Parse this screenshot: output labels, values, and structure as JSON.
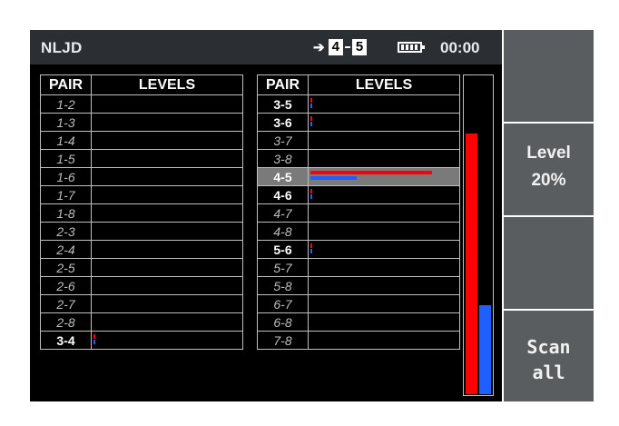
{
  "header": {
    "title": "NLJD",
    "pair_from": "4",
    "pair_to": "5",
    "battery_icon": "battery-full-icon",
    "time": "00:00"
  },
  "table_left": {
    "headers": [
      "PAIR",
      "LEVELS"
    ],
    "rows": [
      {
        "pair": "1-2",
        "active": false,
        "red": 0,
        "blue": 0
      },
      {
        "pair": "1-3",
        "active": false,
        "red": 0,
        "blue": 0
      },
      {
        "pair": "1-4",
        "active": false,
        "red": 0,
        "blue": 0
      },
      {
        "pair": "1-5",
        "active": false,
        "red": 0,
        "blue": 0
      },
      {
        "pair": "1-6",
        "active": false,
        "red": 0,
        "blue": 0
      },
      {
        "pair": "1-7",
        "active": false,
        "red": 0,
        "blue": 0
      },
      {
        "pair": "1-8",
        "active": false,
        "red": 0,
        "blue": 0
      },
      {
        "pair": "2-3",
        "active": false,
        "red": 0,
        "blue": 0
      },
      {
        "pair": "2-4",
        "active": false,
        "red": 0,
        "blue": 0
      },
      {
        "pair": "2-5",
        "active": false,
        "red": 0,
        "blue": 0
      },
      {
        "pair": "2-6",
        "active": false,
        "red": 0,
        "blue": 0
      },
      {
        "pair": "2-7",
        "active": false,
        "red": 0,
        "blue": 0
      },
      {
        "pair": "2-8",
        "active": false,
        "red": 0,
        "blue": 0
      },
      {
        "pair": "3-4",
        "active": true,
        "red": 0.01,
        "blue": 0.01
      }
    ]
  },
  "table_right": {
    "headers": [
      "PAIR",
      "LEVELS"
    ],
    "rows": [
      {
        "pair": "3-5",
        "active": true,
        "red": 0.01,
        "blue": 0.01
      },
      {
        "pair": "3-6",
        "active": true,
        "red": 0.01,
        "blue": 0.01
      },
      {
        "pair": "3-7",
        "active": false,
        "red": 0,
        "blue": 0
      },
      {
        "pair": "3-8",
        "active": false,
        "red": 0,
        "blue": 0
      },
      {
        "pair": "4-5",
        "active": true,
        "selected": true,
        "red": 0.81,
        "blue": 0.31
      },
      {
        "pair": "4-6",
        "active": true,
        "red": 0.01,
        "blue": 0.01
      },
      {
        "pair": "4-7",
        "active": false,
        "red": 0,
        "blue": 0
      },
      {
        "pair": "4-8",
        "active": false,
        "red": 0,
        "blue": 0
      },
      {
        "pair": "5-6",
        "active": true,
        "red": 0.01,
        "blue": 0.01
      },
      {
        "pair": "5-7",
        "active": false,
        "red": 0,
        "blue": 0
      },
      {
        "pair": "5-8",
        "active": false,
        "red": 0,
        "blue": 0
      },
      {
        "pair": "6-7",
        "active": false,
        "red": 0,
        "blue": 0
      },
      {
        "pair": "6-8",
        "active": false,
        "red": 0,
        "blue": 0
      },
      {
        "pair": "7-8",
        "active": false,
        "red": 0,
        "blue": 0
      }
    ]
  },
  "meter": {
    "red_level": 0.82,
    "blue_level": 0.28,
    "red_color": "#ff0000",
    "blue_color": "#1f5eff"
  },
  "buttons": {
    "level_label": "Level",
    "level_value": "20%",
    "scan_line1": "Scan",
    "scan_line2": "all"
  }
}
